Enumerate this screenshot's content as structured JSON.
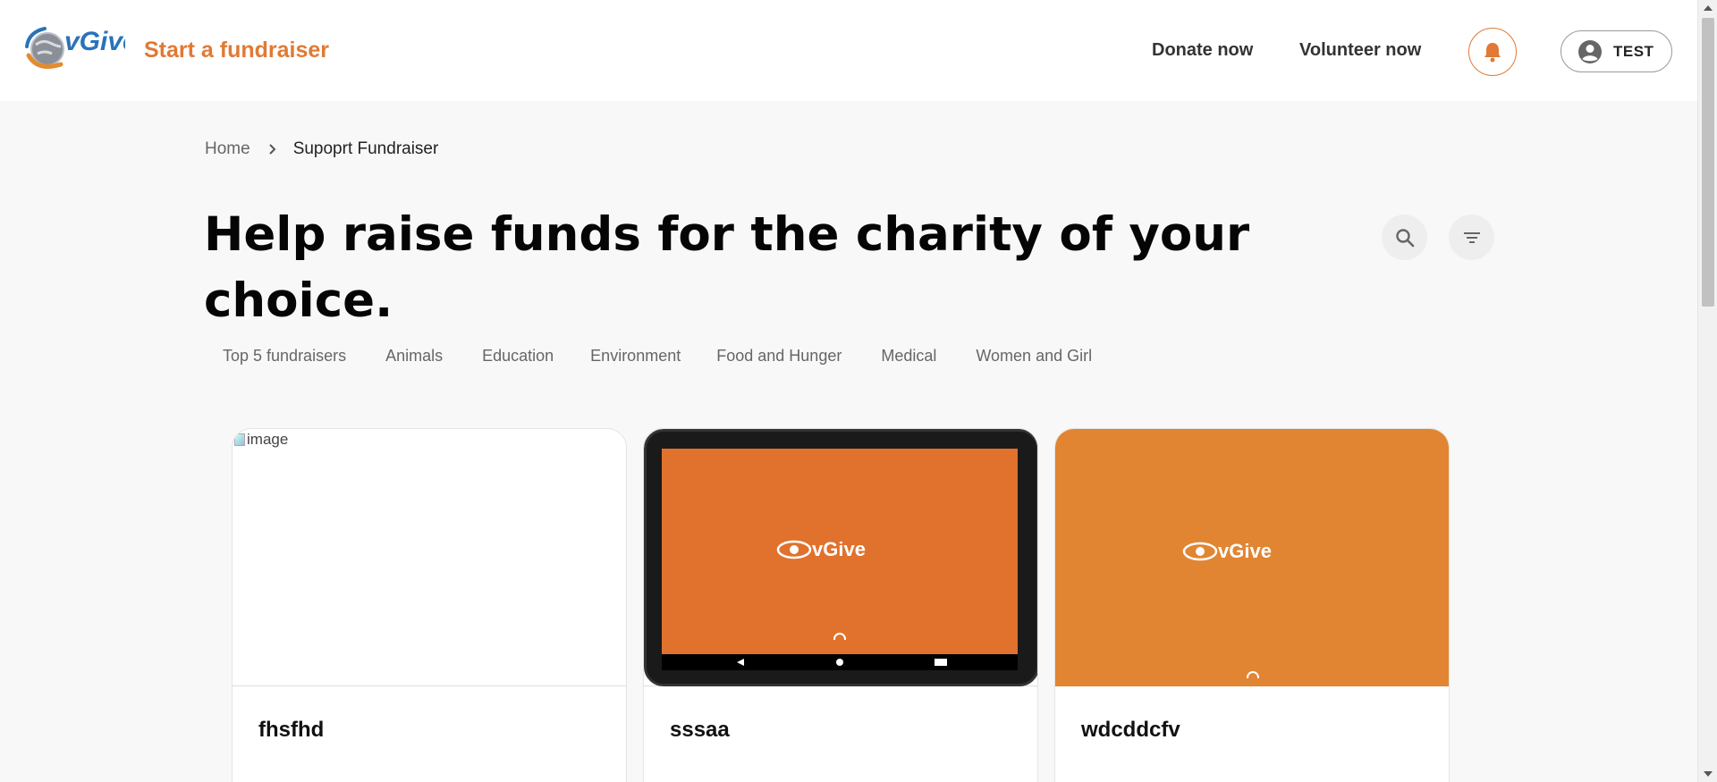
{
  "header": {
    "logo_text": "vGive",
    "start_fundraiser": "Start a fundraiser",
    "nav": {
      "donate": "Donate now",
      "volunteer": "Volunteer now"
    },
    "user_name": "TEST"
  },
  "breadcrumb": {
    "home": "Home",
    "current": "Supoprt Fundraiser"
  },
  "headline": "Help raise funds for the charity of your choice.",
  "categories": [
    "Top 5 fundraisers",
    "Animals",
    "Education",
    "Environment",
    "Food and Hunger",
    "Medical",
    "Women and Girl"
  ],
  "cards": [
    {
      "title": "fhsfhd",
      "image_alt": "image"
    },
    {
      "title": "sssaa",
      "screen_logo": "vGive"
    },
    {
      "title": "wdcddcfv",
      "screen_logo": "vGive"
    }
  ],
  "colors": {
    "accent": "#e07a35",
    "card_orange": "#e18532",
    "phone_screen": "#e0722d"
  }
}
